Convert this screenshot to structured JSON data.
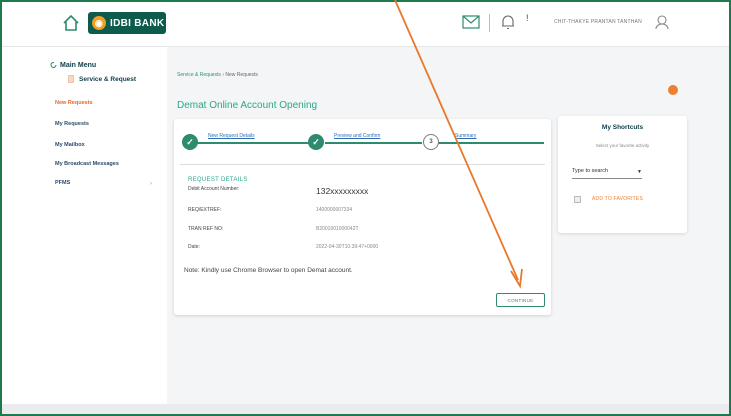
{
  "header": {
    "logo_text": "IDBI BANK",
    "user_name": "CHIT-THAKYE PRANTAN TANTHAN"
  },
  "sidebar": {
    "main_menu": "Main Menu",
    "service_request": "Service & Request",
    "items": [
      {
        "label": "New Requests",
        "active": true
      },
      {
        "label": "My Requests",
        "active": false
      },
      {
        "label": "My Mailbox",
        "active": false
      },
      {
        "label": "My Broadcast Messages",
        "active": false
      },
      {
        "label": "PFMS",
        "active": false
      }
    ]
  },
  "main": {
    "breadcrumb": {
      "first": "Service & Requests",
      "sep": "›",
      "last": "New Requests"
    },
    "title": "Demat Online Account Opening",
    "steps": [
      {
        "label": "New Request Details",
        "state": "done"
      },
      {
        "label": "Preview and Confirm",
        "state": "done"
      },
      {
        "label": "Summary",
        "state": "pending",
        "number": "3"
      }
    ],
    "details": {
      "heading": "REQUEST DETAILS",
      "rows": [
        {
          "label": "Debit Account Number:",
          "value": "132xxxxxxxxx"
        },
        {
          "label": "REQ/EXTREF:",
          "value": "1400000007334"
        },
        {
          "label": "TRAN REF NO:",
          "value": "B2001001000042T"
        },
        {
          "label": "Date:",
          "value": "2022-04-30T10:39:47+0000"
        }
      ]
    },
    "note": "Note: Kindly use Chrome Browser to open Demat account.",
    "continue_label": "CONTINUE"
  },
  "shortcuts": {
    "title": "My Shortcuts",
    "subtitle": "Select your favorite activity",
    "search_placeholder": "Type to search",
    "add_label": "ADD TO FAVORITES"
  },
  "colors": {
    "accent": "#2e8b6f",
    "brand": "#0d5c4b",
    "orange": "#ef7e2e",
    "frame": "#1e7a4c"
  }
}
